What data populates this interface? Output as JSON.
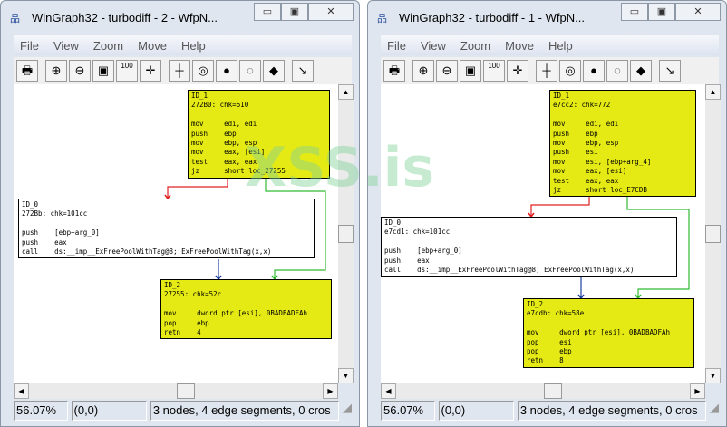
{
  "windows": [
    {
      "title": "WinGraph32 - turbodiff - 2 - WfpN...",
      "menu": [
        "File",
        "View",
        "Zoom",
        "Move",
        "Help"
      ],
      "status": {
        "zoom": "56.07%",
        "coords": "(0,0)",
        "info": "3 nodes, 4 edge segments, 0 cros"
      },
      "nodes": [
        {
          "id": "ID_1",
          "header": "ID_1\n272B0: chk=610",
          "body": "\nmov     edi, edi\npush    ebp\nmov     ebp, esp\nmov     eax, [esi]\ntest    eax, eax\njz      short loc_27255",
          "color": "yellow"
        },
        {
          "id": "ID_0",
          "header": "ID_0\n272Bb: chk=101cc",
          "body": "\npush    [ebp+arg_0]\npush    eax\ncall    ds:__imp__ExFreePoolWithTag@8; ExFreePoolWithTag(x,x)",
          "color": "white"
        },
        {
          "id": "ID_2",
          "header": "ID_2\n27255: chk=52c",
          "body": "\nmov     dword ptr [esi], 0BADBADFAh\npop     ebp\nretn    4",
          "color": "yellow"
        }
      ]
    },
    {
      "title": "WinGraph32 - turbodiff - 1 - WfpN...",
      "menu": [
        "File",
        "View",
        "Zoom",
        "Move",
        "Help"
      ],
      "status": {
        "zoom": "56.07%",
        "coords": "(0,0)",
        "info": "3 nodes, 4 edge segments, 0 cros"
      },
      "nodes": [
        {
          "id": "ID_1",
          "header": "ID_1\ne7cc2: chk=772",
          "body": "\nmov     edi, edi\npush    ebp\nmov     ebp, esp\npush    esi\nmov     esi, [ebp+arg_4]\nmov     eax, [esi]\ntest    eax, eax\njz      short loc_E7CDB",
          "color": "yellow"
        },
        {
          "id": "ID_0",
          "header": "ID_0\ne7cd1: chk=101cc",
          "body": "\npush    [ebp+arg_0]\npush    eax\ncall    ds:__imp__ExFreePoolWithTag@8; ExFreePoolWithTag(x,x)",
          "color": "white"
        },
        {
          "id": "ID_2",
          "header": "ID_2\ne7cdb: chk=58e",
          "body": "\nmov     dword ptr [esi], 0BADBADFAh\npop     esi\npop     ebp\nretn    8",
          "color": "yellow"
        }
      ]
    }
  ],
  "toolbar_icons": [
    "print-icon",
    "zoom-in-icon",
    "zoom-out-icon",
    "fit-icon",
    "zoom-100-icon",
    "center-icon",
    "north-icon",
    "fish-eye-icon",
    "fish-eye-filled-icon",
    "poly-fish-icon",
    "poly-fish-filled-icon",
    "edge-follow-icon"
  ],
  "toolbar_glyphs": [
    "🖶",
    "⊕",
    "⊖",
    "▣",
    "100",
    "✛",
    "┼",
    "◎",
    "●",
    "◌",
    "◆",
    "↘"
  ],
  "colors": {
    "node_yellow": "#e5ea14",
    "edge_true": "#e02020",
    "edge_false": "#33bb33",
    "edge_normal": "#1f3fa0"
  },
  "watermark": "XSS.is"
}
